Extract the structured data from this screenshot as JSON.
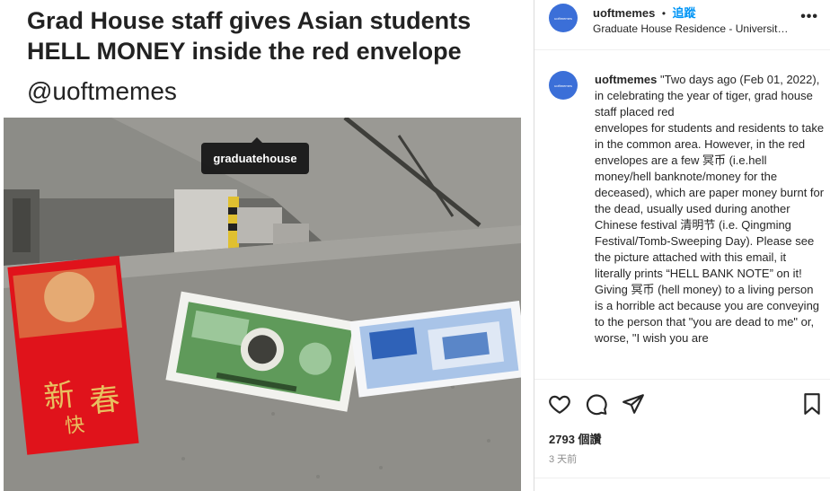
{
  "meme": {
    "headline": "Grad House staff gives Asian students HELL MONEY inside the red envelope",
    "handle": "@uoftmemes",
    "tag_label": "graduatehouse"
  },
  "header": {
    "username": "uoftmemes",
    "separator": "•",
    "follow_label": "追蹤",
    "location": "Graduate House Residence - University...",
    "more_label": "•••"
  },
  "caption": {
    "username": "uoftmemes",
    "lines": [
      "\"Two days ago (Feb 01, 2022), in celebrating the year of tiger, grad house staff placed red",
      "envelopes for students and residents to take in the common area. However, in the red",
      "envelopes are a few 冥币 (i.e.hell money/hell banknote/money for the deceased), which are paper money burnt for the dead, usually used during another Chinese festival 清明节 (i.e. Qingming Festival/Tomb-Sweeping Day). Please see the picture attached with this email, it literally prints “HELL BANK NOTE” on it!",
      "Giving 冥币 (hell money) to a living person is a horrible act because you are conveying to the person that \"you are dead to me\" or, worse, \"I wish you are"
    ]
  },
  "actions": {
    "likes": "2793 個讚",
    "time": "3 天前"
  },
  "icons": {
    "like": "heart-icon",
    "comment": "comment-icon",
    "share": "send-icon",
    "save": "bookmark-icon"
  },
  "colors": {
    "link": "#0095f6",
    "avatar": "#3b6fd8"
  }
}
